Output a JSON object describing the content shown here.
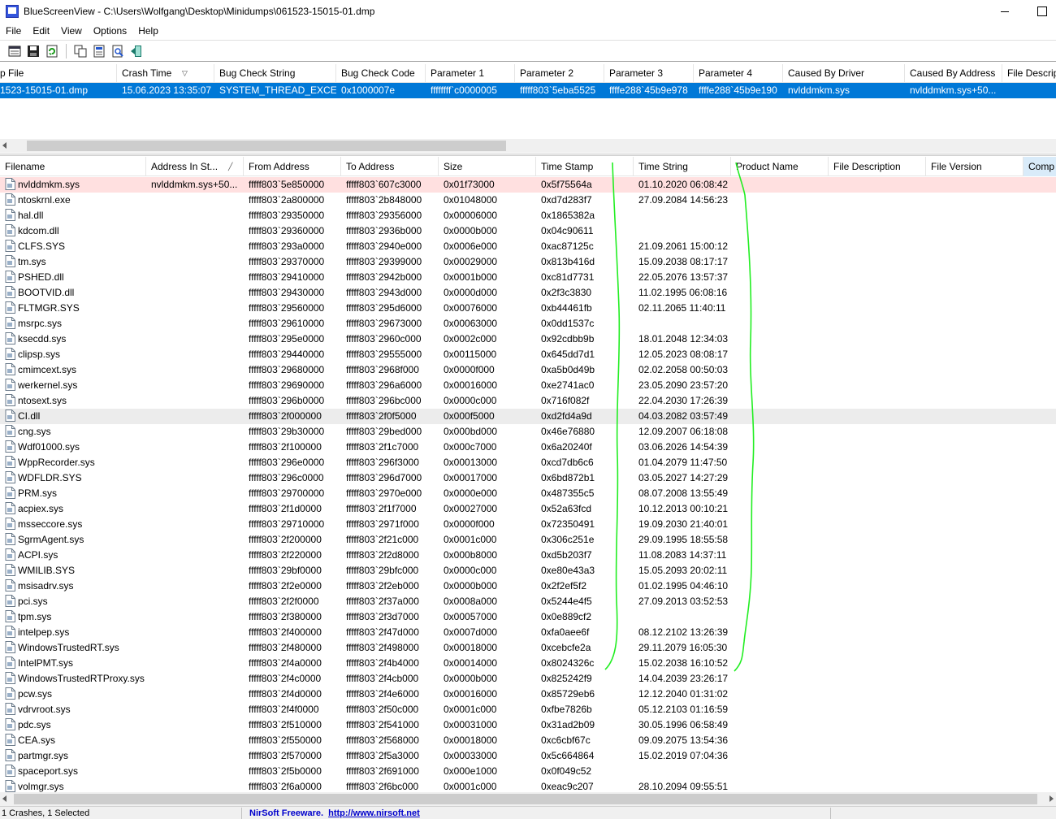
{
  "window": {
    "app_name": "BlueScreenView",
    "title": "BlueScreenView   -   C:\\Users\\Wolfgang\\Desktop\\Minidumps\\061523-15015-01.dmp"
  },
  "menu": [
    "File",
    "Edit",
    "View",
    "Options",
    "Help"
  ],
  "toolbar_icons": [
    "properties-icon",
    "save-icon",
    "refresh-icon",
    "copy-icon",
    "html-report-icon",
    "find-icon",
    "exit-icon"
  ],
  "dumps": {
    "columns": [
      "p File",
      "Crash Time",
      "Bug Check String",
      "Bug Check Code",
      "Parameter 1",
      "Parameter 2",
      "Parameter 3",
      "Parameter 4",
      "Caused By Driver",
      "Caused By Address",
      "File Descrip"
    ],
    "rows": [
      [
        "1523-15015-01.dmp",
        "15.06.2023 13:35:07",
        "SYSTEM_THREAD_EXCE...",
        "0x1000007e",
        "ffffffff`c0000005",
        "fffff803`5eba5525",
        "ffffe288`45b9e978",
        "ffffe288`45b9e190",
        "nvlddmkm.sys",
        "nvlddmkm.sys+50...",
        ""
      ]
    ]
  },
  "drivers": {
    "columns": [
      "Filename",
      "Address In St...",
      "From Address",
      "To Address",
      "Size",
      "Time Stamp",
      "Time String",
      "Product Name",
      "File Description",
      "File Version",
      "Comp"
    ],
    "rows": [
      [
        "nvlddmkm.sys",
        "nvlddmkm.sys+50...",
        "fffff803`5e850000",
        "fffff803`607c3000",
        "0x01f73000",
        "0x5f75564a",
        "01.10.2020 06:08:42"
      ],
      [
        "ntoskrnl.exe",
        "",
        "fffff803`2a800000",
        "fffff803`2b848000",
        "0x01048000",
        "0xd7d283f7",
        "27.09.2084 14:56:23"
      ],
      [
        "hal.dll",
        "",
        "fffff803`29350000",
        "fffff803`29356000",
        "0x00006000",
        "0x1865382a",
        ""
      ],
      [
        "kdcom.dll",
        "",
        "fffff803`29360000",
        "fffff803`2936b000",
        "0x0000b000",
        "0x04c90611",
        ""
      ],
      [
        "CLFS.SYS",
        "",
        "fffff803`293a0000",
        "fffff803`2940e000",
        "0x0006e000",
        "0xac87125c",
        "21.09.2061 15:00:12"
      ],
      [
        "tm.sys",
        "",
        "fffff803`29370000",
        "fffff803`29399000",
        "0x00029000",
        "0x813b416d",
        "15.09.2038 08:17:17"
      ],
      [
        "PSHED.dll",
        "",
        "fffff803`29410000",
        "fffff803`2942b000",
        "0x0001b000",
        "0xc81d7731",
        "22.05.2076 13:57:37"
      ],
      [
        "BOOTVID.dll",
        "",
        "fffff803`29430000",
        "fffff803`2943d000",
        "0x0000d000",
        "0x2f3c3830",
        "11.02.1995 06:08:16"
      ],
      [
        "FLTMGR.SYS",
        "",
        "fffff803`29560000",
        "fffff803`295d6000",
        "0x00076000",
        "0xb44461fb",
        "02.11.2065 11:40:11"
      ],
      [
        "msrpc.sys",
        "",
        "fffff803`29610000",
        "fffff803`29673000",
        "0x00063000",
        "0x0dd1537c",
        ""
      ],
      [
        "ksecdd.sys",
        "",
        "fffff803`295e0000",
        "fffff803`2960c000",
        "0x0002c000",
        "0x92cdbb9b",
        "18.01.2048 12:34:03"
      ],
      [
        "clipsp.sys",
        "",
        "fffff803`29440000",
        "fffff803`29555000",
        "0x00115000",
        "0x645dd7d1",
        "12.05.2023 08:08:17"
      ],
      [
        "cmimcext.sys",
        "",
        "fffff803`29680000",
        "fffff803`2968f000",
        "0x0000f000",
        "0xa5b0d49b",
        "02.02.2058 00:50:03"
      ],
      [
        "werkernel.sys",
        "",
        "fffff803`29690000",
        "fffff803`296a6000",
        "0x00016000",
        "0xe2741ac0",
        "23.05.2090 23:57:20"
      ],
      [
        "ntosext.sys",
        "",
        "fffff803`296b0000",
        "fffff803`296bc000",
        "0x0000c000",
        "0x716f082f",
        "22.04.2030 17:26:39"
      ],
      [
        "CI.dll",
        "",
        "fffff803`2f000000",
        "fffff803`2f0f5000",
        "0x000f5000",
        "0xd2fd4a9d",
        "04.03.2082 03:57:49"
      ],
      [
        "cng.sys",
        "",
        "fffff803`29b30000",
        "fffff803`29bed000",
        "0x000bd000",
        "0x46e76880",
        "12.09.2007 06:18:08"
      ],
      [
        "Wdf01000.sys",
        "",
        "fffff803`2f100000",
        "fffff803`2f1c7000",
        "0x000c7000",
        "0x6a20240f",
        "03.06.2026 14:54:39"
      ],
      [
        "WppRecorder.sys",
        "",
        "fffff803`296e0000",
        "fffff803`296f3000",
        "0x00013000",
        "0xcd7db6c6",
        "01.04.2079 11:47:50"
      ],
      [
        "WDFLDR.SYS",
        "",
        "fffff803`296c0000",
        "fffff803`296d7000",
        "0x00017000",
        "0x6bd872b1",
        "03.05.2027 14:27:29"
      ],
      [
        "PRM.sys",
        "",
        "fffff803`29700000",
        "fffff803`2970e000",
        "0x0000e000",
        "0x487355c5",
        "08.07.2008 13:55:49"
      ],
      [
        "acpiex.sys",
        "",
        "fffff803`2f1d0000",
        "fffff803`2f1f7000",
        "0x00027000",
        "0x52a63fcd",
        "10.12.2013 00:10:21"
      ],
      [
        "msseccore.sys",
        "",
        "fffff803`29710000",
        "fffff803`2971f000",
        "0x0000f000",
        "0x72350491",
        "19.09.2030 21:40:01"
      ],
      [
        "SgrmAgent.sys",
        "",
        "fffff803`2f200000",
        "fffff803`2f21c000",
        "0x0001c000",
        "0x306c251e",
        "29.09.1995 18:55:58"
      ],
      [
        "ACPI.sys",
        "",
        "fffff803`2f220000",
        "fffff803`2f2d8000",
        "0x000b8000",
        "0xd5b203f7",
        "11.08.2083 14:37:11"
      ],
      [
        "WMILIB.SYS",
        "",
        "fffff803`29bf0000",
        "fffff803`29bfc000",
        "0x0000c000",
        "0xe80e43a3",
        "15.05.2093 20:02:11"
      ],
      [
        "msisadrv.sys",
        "",
        "fffff803`2f2e0000",
        "fffff803`2f2eb000",
        "0x0000b000",
        "0x2f2ef5f2",
        "01.02.1995 04:46:10"
      ],
      [
        "pci.sys",
        "",
        "fffff803`2f2f0000",
        "fffff803`2f37a000",
        "0x0008a000",
        "0x5244e4f5",
        "27.09.2013 03:52:53"
      ],
      [
        "tpm.sys",
        "",
        "fffff803`2f380000",
        "fffff803`2f3d7000",
        "0x00057000",
        "0x0e889cf2",
        ""
      ],
      [
        "intelpep.sys",
        "",
        "fffff803`2f400000",
        "fffff803`2f47d000",
        "0x0007d000",
        "0xfa0aee6f",
        "08.12.2102 13:26:39"
      ],
      [
        "WindowsTrustedRT.sys",
        "",
        "fffff803`2f480000",
        "fffff803`2f498000",
        "0x00018000",
        "0xcebcfe2a",
        "29.11.2079 16:05:30"
      ],
      [
        "IntelPMT.sys",
        "",
        "fffff803`2f4a0000",
        "fffff803`2f4b4000",
        "0x00014000",
        "0x8024326c",
        "15.02.2038 16:10:52"
      ],
      [
        "WindowsTrustedRTProxy.sys",
        "",
        "fffff803`2f4c0000",
        "fffff803`2f4cb000",
        "0x0000b000",
        "0x825242f9",
        "14.04.2039 23:26:17"
      ],
      [
        "pcw.sys",
        "",
        "fffff803`2f4d0000",
        "fffff803`2f4e6000",
        "0x00016000",
        "0x85729eb6",
        "12.12.2040 01:31:02"
      ],
      [
        "vdrvroot.sys",
        "",
        "fffff803`2f4f0000",
        "fffff803`2f50c000",
        "0x0001c000",
        "0xfbe7826b",
        "05.12.2103 01:16:59"
      ],
      [
        "pdc.sys",
        "",
        "fffff803`2f510000",
        "fffff803`2f541000",
        "0x00031000",
        "0x31ad2b09",
        "30.05.1996 06:58:49"
      ],
      [
        "CEA.sys",
        "",
        "fffff803`2f550000",
        "fffff803`2f568000",
        "0x00018000",
        "0xc6cbf67c",
        "09.09.2075 13:54:36"
      ],
      [
        "partmgr.sys",
        "",
        "fffff803`2f570000",
        "fffff803`2f5a3000",
        "0x00033000",
        "0x5c664864",
        "15.02.2019 07:04:36"
      ],
      [
        "spaceport.sys",
        "",
        "fffff803`2f5b0000",
        "fffff803`2f691000",
        "0x000e1000",
        "0x0f049c52",
        ""
      ],
      [
        "volmgr.sys",
        "",
        "fffff803`2f6a0000",
        "fffff803`2f6bc000",
        "0x0001c000",
        "0xeac9c207",
        "28.10.2094 09:55:51"
      ]
    ]
  },
  "status": {
    "left": "1 Crashes, 1 Selected",
    "brand": "NirSoft Freeware.",
    "url": "http://www.nirsoft.net"
  },
  "colors": {
    "selection": "#0078d7",
    "highlight_red": "#ffe0e0",
    "annotation_green": "#22ee22"
  }
}
